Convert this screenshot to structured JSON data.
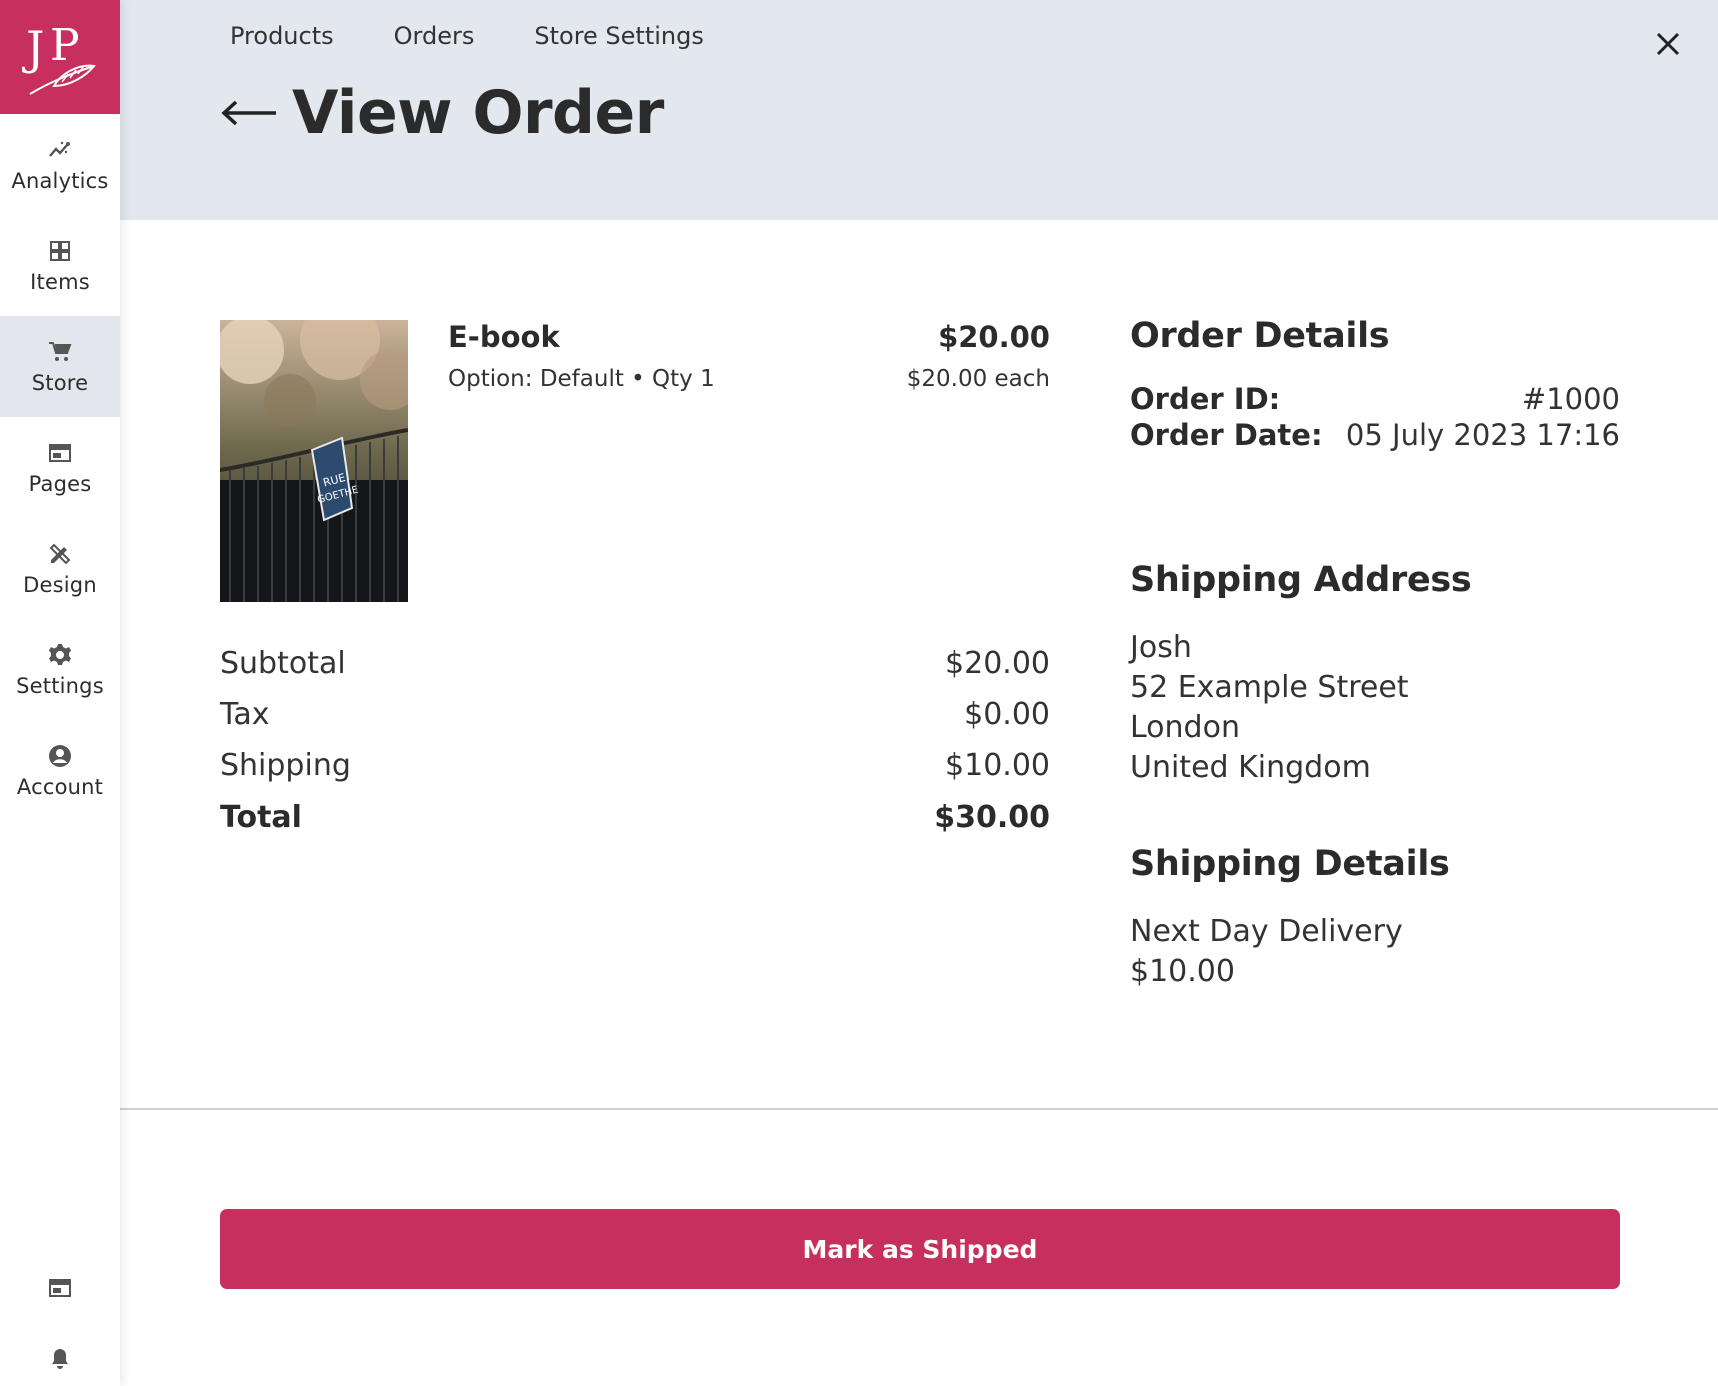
{
  "brand": {
    "accent": "#c7305e",
    "logo_text": "JP"
  },
  "sidebar": {
    "items": [
      {
        "label": "Analytics",
        "icon": "analytics-icon"
      },
      {
        "label": "Items",
        "icon": "grid-icon"
      },
      {
        "label": "Store",
        "icon": "cart-icon",
        "active": true
      },
      {
        "label": "Pages",
        "icon": "pages-icon"
      },
      {
        "label": "Design",
        "icon": "design-tools-icon"
      },
      {
        "label": "Settings",
        "icon": "gear-icon"
      },
      {
        "label": "Account",
        "icon": "account-icon"
      }
    ],
    "bottom": [
      {
        "icon": "window-icon"
      },
      {
        "icon": "bell-icon"
      }
    ]
  },
  "header": {
    "tabs": [
      "Products",
      "Orders",
      "Store Settings"
    ],
    "title": "View Order"
  },
  "order": {
    "item": {
      "name": "E-book",
      "meta": "Option: Default • Qty 1",
      "price": "$20.00",
      "each": "$20.00 each"
    },
    "summary": {
      "subtotal_label": "Subtotal",
      "subtotal": "$20.00",
      "tax_label": "Tax",
      "tax": "$0.00",
      "shipping_label": "Shipping",
      "shipping": "$10.00",
      "total_label": "Total",
      "total": "$30.00"
    },
    "details": {
      "title": "Order Details",
      "id_label": "Order ID:",
      "id": "#1000",
      "date_label": "Order Date:",
      "date": "05 July 2023 17:16"
    },
    "shipping_address": {
      "title": "Shipping Address",
      "lines": [
        "Josh",
        "52 Example Street",
        "London",
        "United Kingdom"
      ]
    },
    "shipping_details": {
      "title": "Shipping Details",
      "method": "Next Day Delivery",
      "cost": "$10.00"
    },
    "action_label": "Mark as Shipped"
  }
}
